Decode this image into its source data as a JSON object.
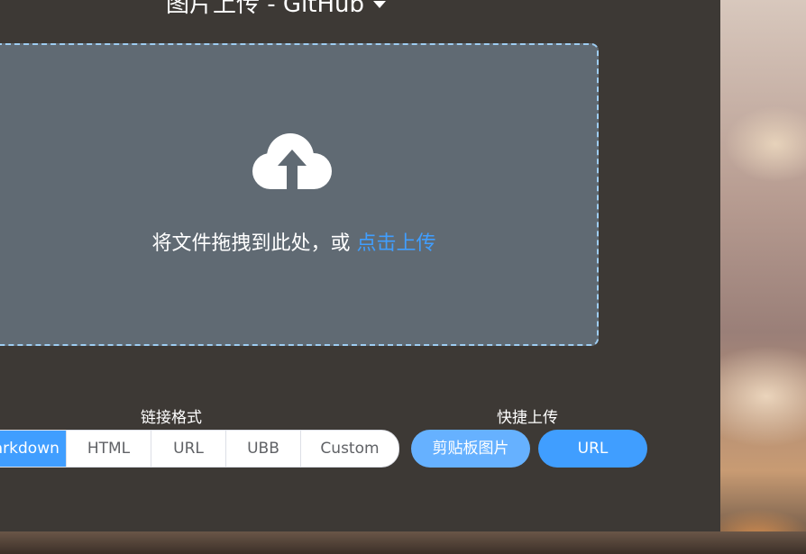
{
  "header": {
    "title": "图片上传 - GitHub"
  },
  "upload": {
    "prompt": "将文件拖拽到此处，或 ",
    "link": "点击上传"
  },
  "link_format": {
    "label": "链接格式",
    "options": [
      "Markdown",
      "HTML",
      "URL",
      "UBB",
      "Custom"
    ],
    "active": "Markdown"
  },
  "quick_upload": {
    "label": "快捷上传",
    "clipboard_label": "剪贴板图片",
    "url_label": "URL"
  },
  "colors": {
    "accent": "#409eff",
    "accent_light": "#66b1ff",
    "panel": "#3d3935",
    "dropzone": "#606a73",
    "dropzone_border": "#9ecdf2"
  }
}
